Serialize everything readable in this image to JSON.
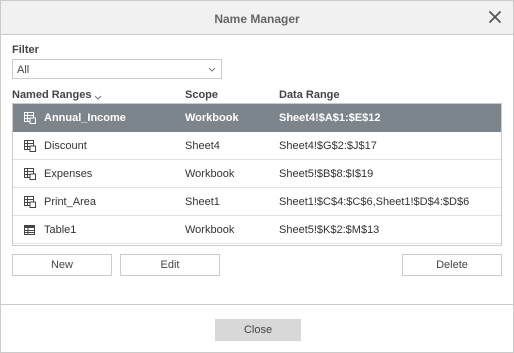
{
  "dialog": {
    "title": "Name Manager",
    "close_icon": "close-icon"
  },
  "filter": {
    "label": "Filter",
    "value": "All"
  },
  "columns": {
    "name": "Named Ranges",
    "scope": "Scope",
    "range": "Data Range"
  },
  "rows": [
    {
      "name": "Annual_Income",
      "scope": "Workbook",
      "range": "Sheet4!$A$1:$E$12",
      "icon": "named-range-icon",
      "selected": true
    },
    {
      "name": "Discount",
      "scope": "Sheet4",
      "range": "Sheet4!$G$2:$J$17",
      "icon": "named-range-icon",
      "selected": false
    },
    {
      "name": "Expenses",
      "scope": "Workbook",
      "range": "Sheet5!$B$8:$I$19",
      "icon": "named-range-icon",
      "selected": false
    },
    {
      "name": "Print_Area",
      "scope": "Sheet1",
      "range": "Sheet1!$C$4:$C$6,Sheet1!$D$4:$D$6",
      "icon": "named-range-icon",
      "selected": false
    },
    {
      "name": "Table1",
      "scope": "Workbook",
      "range": "Sheet5!$K$2:$M$13",
      "icon": "table-icon",
      "selected": false
    }
  ],
  "buttons": {
    "new": "New",
    "edit": "Edit",
    "delete": "Delete",
    "close": "Close"
  },
  "colors": {
    "selected_row": "#7d858c",
    "titlebar": "#f1f1f1",
    "border": "#cbcbcb",
    "close_button": "#d8d8d8"
  }
}
